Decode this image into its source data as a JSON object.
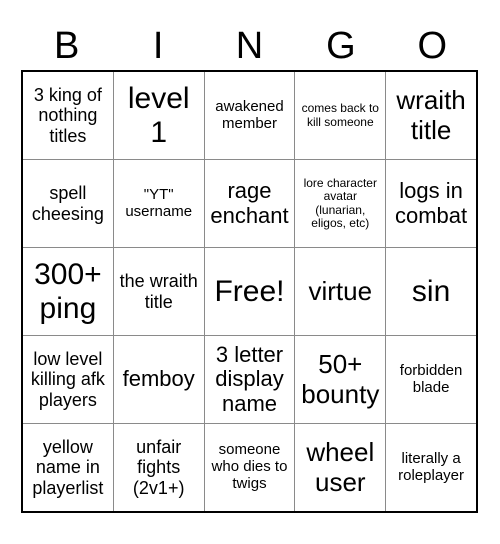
{
  "header": {
    "letters": [
      "B",
      "I",
      "N",
      "G",
      "O"
    ]
  },
  "colors": {
    "background": "#ffffff",
    "text": "#000000",
    "outer_border": "#000000",
    "inner_border": "#8a8a8a"
  },
  "grid": {
    "rows": 5,
    "columns": 5,
    "cells": [
      [
        {
          "text": "3 king of nothing titles",
          "size": "md"
        },
        {
          "text": "level 1",
          "size": "xxl"
        },
        {
          "text": "awakened member",
          "size": "sm"
        },
        {
          "text": "comes back to kill someone",
          "size": "xs"
        },
        {
          "text": "wraith title",
          "size": "xl"
        }
      ],
      [
        {
          "text": "spell cheesing",
          "size": "md"
        },
        {
          "text": "\"YT\" username",
          "size": "sm"
        },
        {
          "text": "rage enchant",
          "size": "lg"
        },
        {
          "text": "lore character avatar (lunarian, eligos, etc)",
          "size": "xs"
        },
        {
          "text": "logs in combat",
          "size": "lg"
        }
      ],
      [
        {
          "text": "300+ ping",
          "size": "xxl"
        },
        {
          "text": "the wraith title",
          "size": "md"
        },
        {
          "text": "Free!",
          "size": "xxl"
        },
        {
          "text": "virtue",
          "size": "xl"
        },
        {
          "text": "sin",
          "size": "xxl"
        }
      ],
      [
        {
          "text": "low level killing afk players",
          "size": "md"
        },
        {
          "text": "femboy",
          "size": "lg"
        },
        {
          "text": "3 letter display name",
          "size": "lg"
        },
        {
          "text": "50+ bounty",
          "size": "xl"
        },
        {
          "text": "forbidden blade",
          "size": "sm"
        }
      ],
      [
        {
          "text": "yellow name in playerlist",
          "size": "md"
        },
        {
          "text": "unfair fights (2v1+)",
          "size": "md"
        },
        {
          "text": "someone who dies to twigs",
          "size": "sm"
        },
        {
          "text": "wheel user",
          "size": "xl"
        },
        {
          "text": "literally a roleplayer",
          "size": "sm"
        }
      ]
    ]
  }
}
